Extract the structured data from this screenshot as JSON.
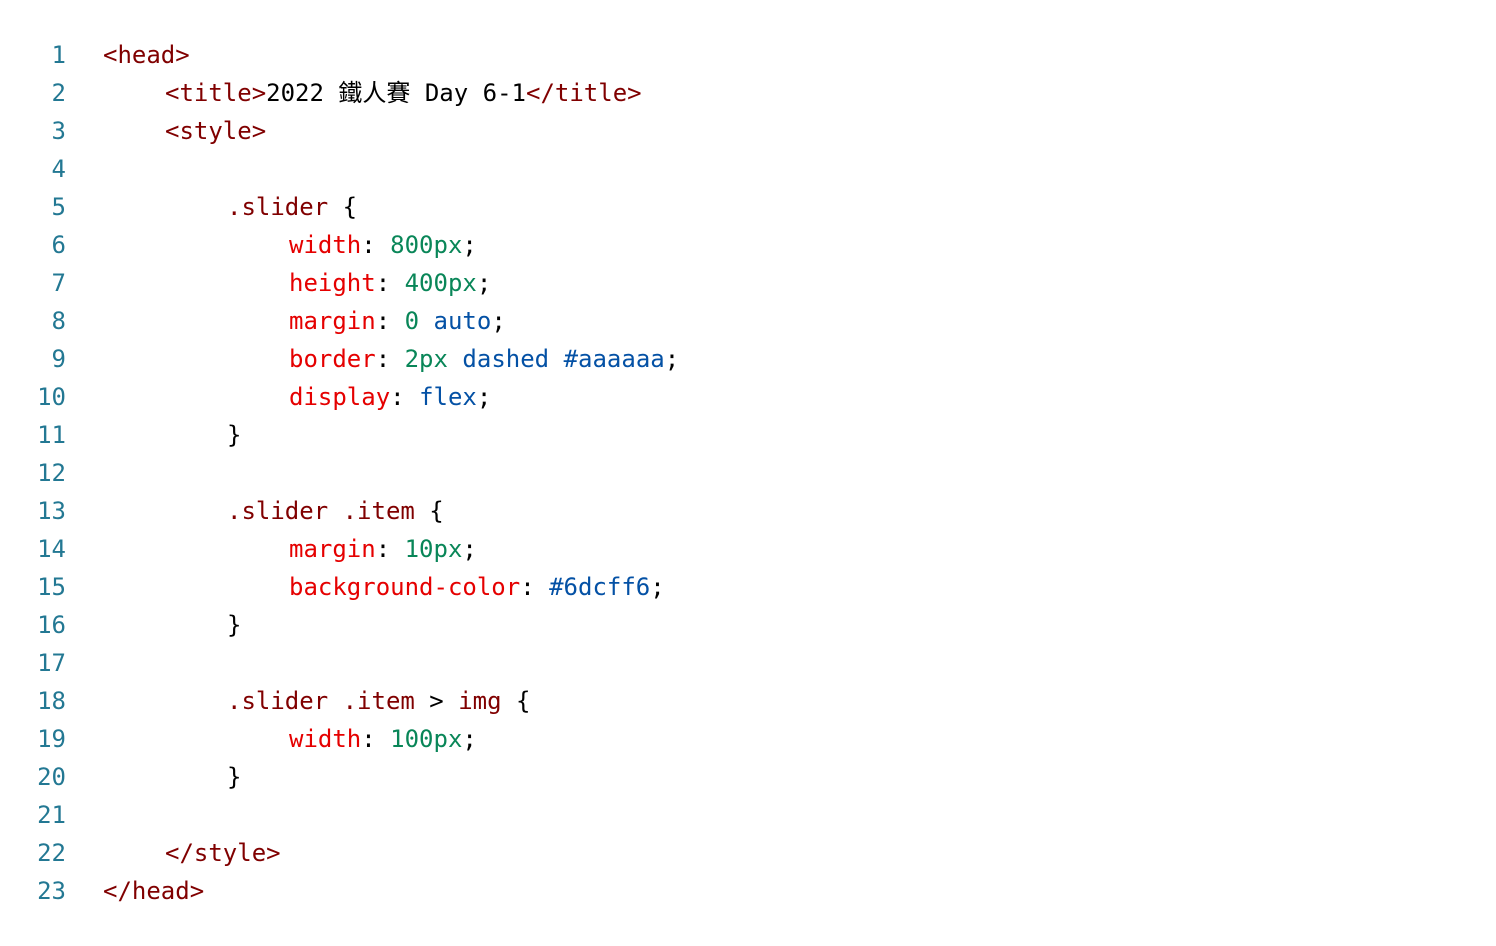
{
  "editor": {
    "language": "html",
    "colors": {
      "line_number": "#237893",
      "tag": "#800000",
      "selector": "#800000",
      "property": "#e50000",
      "number": "#098658",
      "value": "#0451a5",
      "text": "#000000"
    },
    "lines": [
      {
        "n": "1",
        "indent": 0,
        "tokens": [
          {
            "t": "<head>",
            "c": "tag"
          }
        ]
      },
      {
        "n": "2",
        "indent": 1,
        "tokens": [
          {
            "t": "<title>",
            "c": "tag"
          },
          {
            "t": "2022 鐵人賽 Day 6-1",
            "c": "txt"
          },
          {
            "t": "</title>",
            "c": "tag"
          }
        ]
      },
      {
        "n": "3",
        "indent": 1,
        "tokens": [
          {
            "t": "<style>",
            "c": "tag"
          }
        ]
      },
      {
        "n": "4",
        "indent": 0,
        "tokens": []
      },
      {
        "n": "5",
        "indent": 2,
        "tokens": [
          {
            "t": ".slider",
            "c": "sel"
          },
          {
            "t": " {",
            "c": "pun"
          }
        ]
      },
      {
        "n": "6",
        "indent": 3,
        "tokens": [
          {
            "t": "width",
            "c": "prop"
          },
          {
            "t": ": ",
            "c": "pun"
          },
          {
            "t": "800px",
            "c": "num"
          },
          {
            "t": ";",
            "c": "pun"
          }
        ]
      },
      {
        "n": "7",
        "indent": 3,
        "tokens": [
          {
            "t": "height",
            "c": "prop"
          },
          {
            "t": ": ",
            "c": "pun"
          },
          {
            "t": "400px",
            "c": "num"
          },
          {
            "t": ";",
            "c": "pun"
          }
        ]
      },
      {
        "n": "8",
        "indent": 3,
        "tokens": [
          {
            "t": "margin",
            "c": "prop"
          },
          {
            "t": ": ",
            "c": "pun"
          },
          {
            "t": "0",
            "c": "num"
          },
          {
            "t": " ",
            "c": "pun"
          },
          {
            "t": "auto",
            "c": "val"
          },
          {
            "t": ";",
            "c": "pun"
          }
        ]
      },
      {
        "n": "9",
        "indent": 3,
        "tokens": [
          {
            "t": "border",
            "c": "prop"
          },
          {
            "t": ": ",
            "c": "pun"
          },
          {
            "t": "2px",
            "c": "num"
          },
          {
            "t": " ",
            "c": "pun"
          },
          {
            "t": "dashed",
            "c": "val"
          },
          {
            "t": " ",
            "c": "pun"
          },
          {
            "t": "#aaaaaa",
            "c": "val"
          },
          {
            "t": ";",
            "c": "pun"
          }
        ]
      },
      {
        "n": "10",
        "indent": 3,
        "tokens": [
          {
            "t": "display",
            "c": "prop"
          },
          {
            "t": ": ",
            "c": "pun"
          },
          {
            "t": "flex",
            "c": "val"
          },
          {
            "t": ";",
            "c": "pun"
          }
        ]
      },
      {
        "n": "11",
        "indent": 2,
        "tokens": [
          {
            "t": "}",
            "c": "pun"
          }
        ]
      },
      {
        "n": "12",
        "indent": 0,
        "tokens": []
      },
      {
        "n": "13",
        "indent": 2,
        "tokens": [
          {
            "t": ".slider",
            "c": "sel"
          },
          {
            "t": " ",
            "c": "pun"
          },
          {
            "t": ".item",
            "c": "sel"
          },
          {
            "t": " {",
            "c": "pun"
          }
        ]
      },
      {
        "n": "14",
        "indent": 3,
        "tokens": [
          {
            "t": "margin",
            "c": "prop"
          },
          {
            "t": ": ",
            "c": "pun"
          },
          {
            "t": "10px",
            "c": "num"
          },
          {
            "t": ";",
            "c": "pun"
          }
        ]
      },
      {
        "n": "15",
        "indent": 3,
        "tokens": [
          {
            "t": "background-color",
            "c": "prop"
          },
          {
            "t": ": ",
            "c": "pun"
          },
          {
            "t": "#6dcff6",
            "c": "val"
          },
          {
            "t": ";",
            "c": "pun"
          }
        ]
      },
      {
        "n": "16",
        "indent": 2,
        "tokens": [
          {
            "t": "}",
            "c": "pun"
          }
        ]
      },
      {
        "n": "17",
        "indent": 0,
        "tokens": []
      },
      {
        "n": "18",
        "indent": 2,
        "tokens": [
          {
            "t": ".slider",
            "c": "sel"
          },
          {
            "t": " ",
            "c": "pun"
          },
          {
            "t": ".item",
            "c": "sel"
          },
          {
            "t": " > ",
            "c": "pun"
          },
          {
            "t": "img",
            "c": "sel"
          },
          {
            "t": " {",
            "c": "pun"
          }
        ]
      },
      {
        "n": "19",
        "indent": 3,
        "tokens": [
          {
            "t": "width",
            "c": "prop"
          },
          {
            "t": ": ",
            "c": "pun"
          },
          {
            "t": "100px",
            "c": "num"
          },
          {
            "t": ";",
            "c": "pun"
          }
        ]
      },
      {
        "n": "20",
        "indent": 2,
        "tokens": [
          {
            "t": "}",
            "c": "pun"
          }
        ]
      },
      {
        "n": "21",
        "indent": 0,
        "tokens": []
      },
      {
        "n": "22",
        "indent": 1,
        "tokens": [
          {
            "t": "</style>",
            "c": "tag"
          }
        ]
      },
      {
        "n": "23",
        "indent": 0,
        "tokens": [
          {
            "t": "</head>",
            "c": "tag"
          }
        ]
      }
    ]
  }
}
